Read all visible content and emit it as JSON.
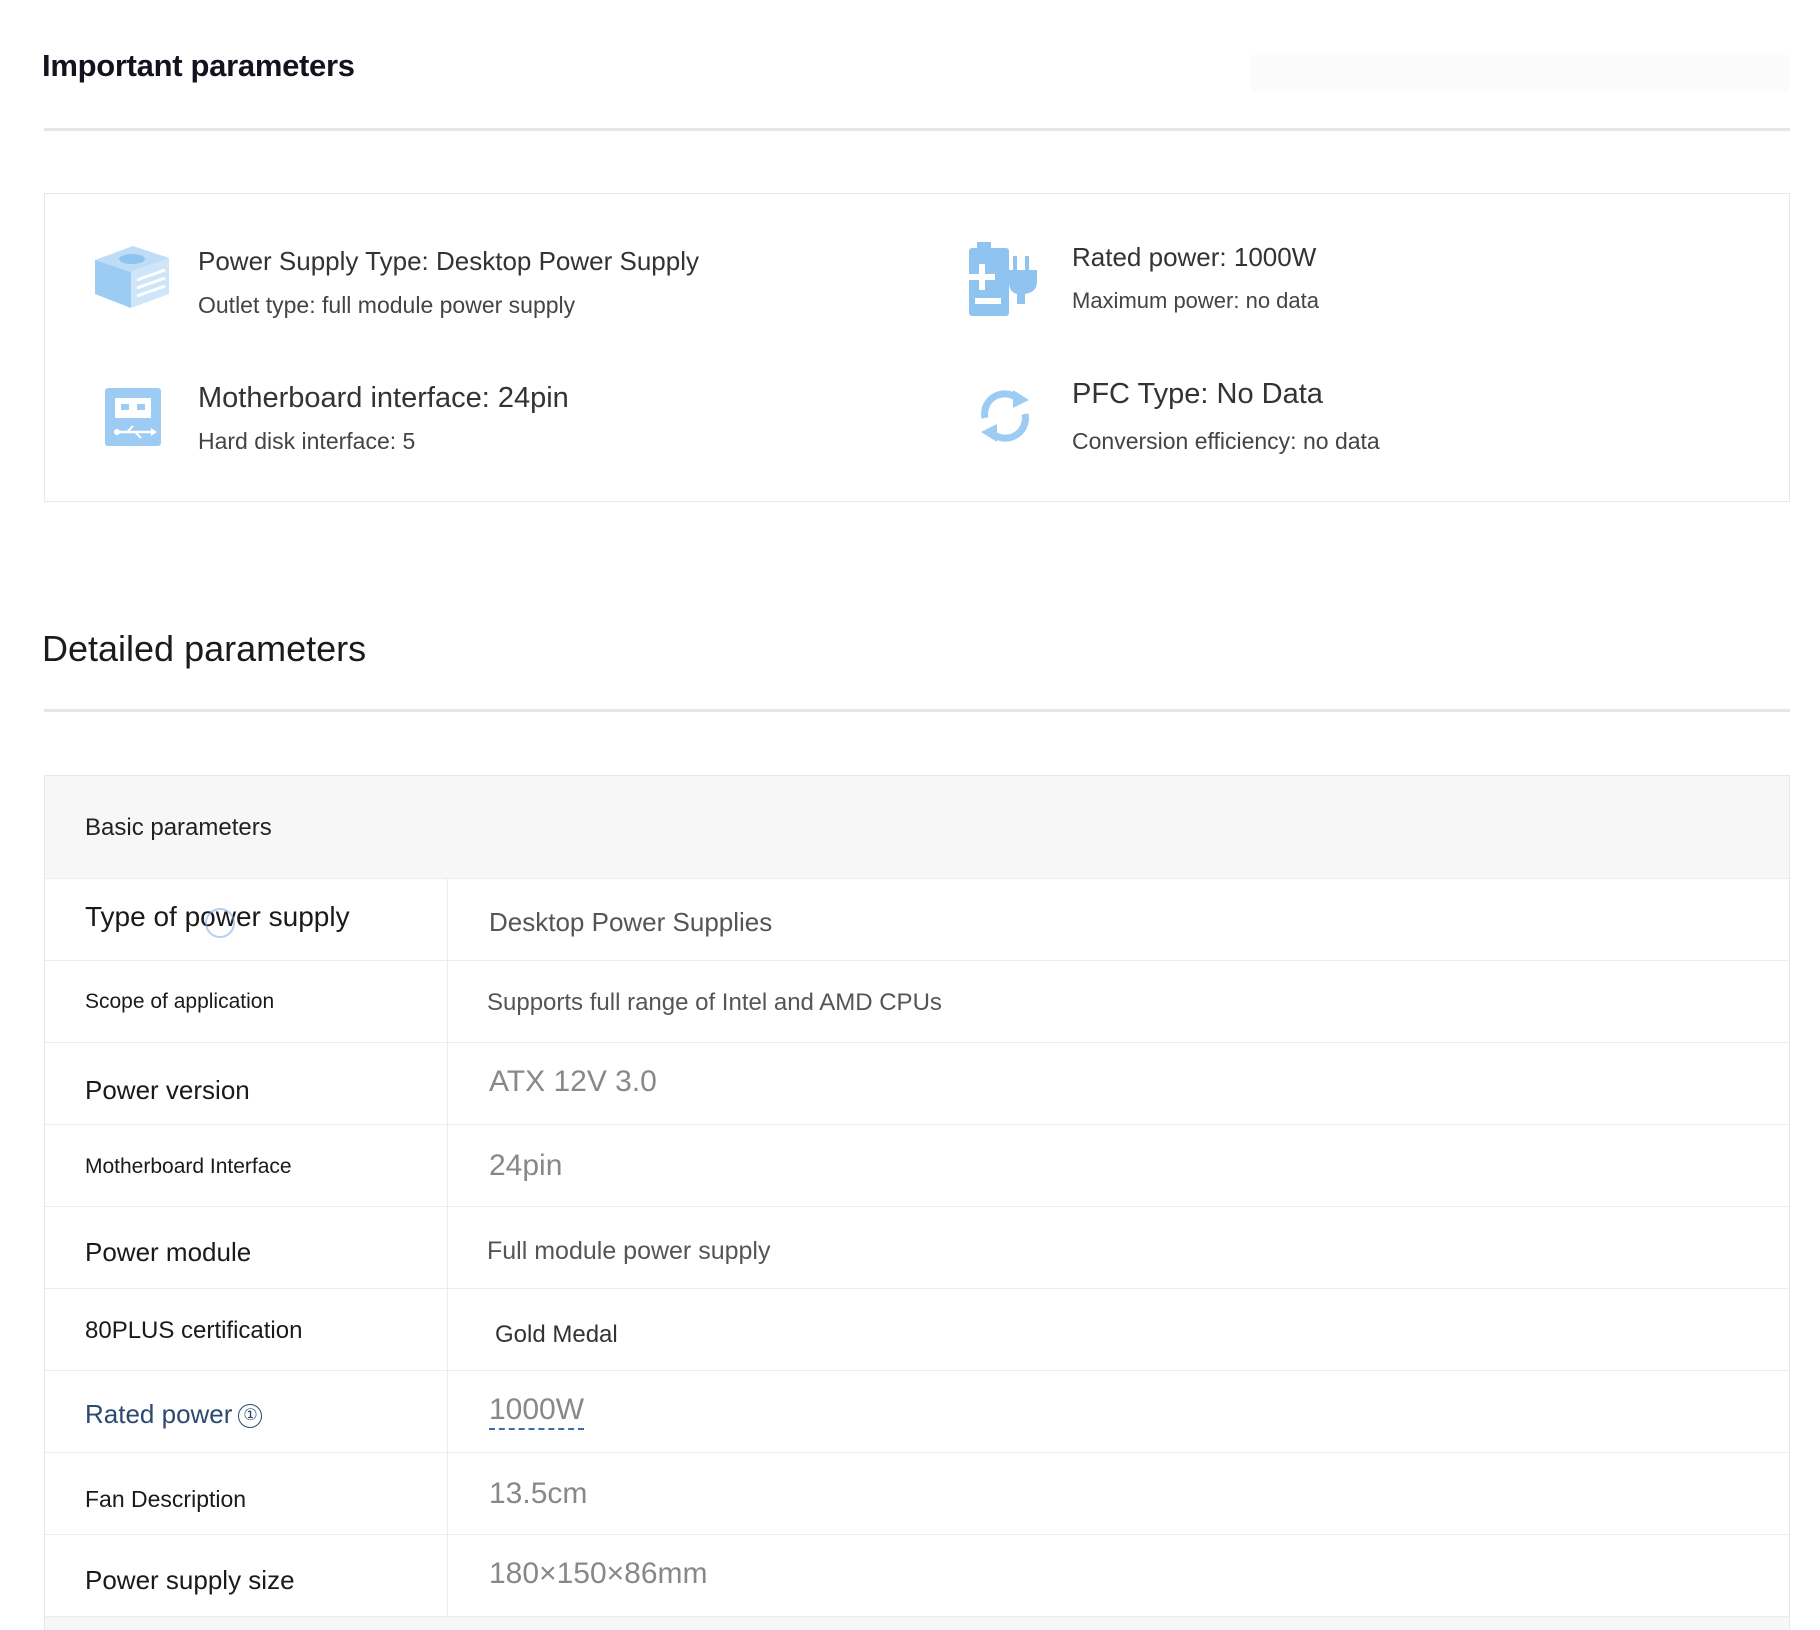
{
  "important": {
    "title": "Important parameters",
    "items": [
      {
        "icon": "power-supply-box-icon",
        "main": "Power Supply Type: Desktop Power Supply",
        "sub": "Outlet type: full module power supply"
      },
      {
        "icon": "battery-plug-icon",
        "main": "Rated power: 1000W",
        "sub": "Maximum power: no data"
      },
      {
        "icon": "usb-port-icon",
        "main": "Motherboard interface: 24pin",
        "sub": "Hard disk interface: 5"
      },
      {
        "icon": "refresh-cycle-icon",
        "main": "PFC Type: No Data",
        "sub": "Conversion efficiency: no data"
      }
    ]
  },
  "detailed": {
    "title": "Detailed parameters",
    "group": "Basic parameters",
    "rows": [
      {
        "label": "Type of power supply",
        "value": "Desktop Power Supplies"
      },
      {
        "label": "Scope of application",
        "value": "Supports full range of Intel and AMD CPUs"
      },
      {
        "label": "Power version",
        "value": "ATX 12V 3.0"
      },
      {
        "label": "Motherboard Interface",
        "value": "24pin"
      },
      {
        "label": "Power module",
        "value": "Full module power supply"
      },
      {
        "label": "80PLUS certification",
        "value": "Gold Medal"
      },
      {
        "label": "Rated power",
        "value": "1000W",
        "info": "①"
      },
      {
        "label": "Fan Description",
        "value": "13.5cm"
      },
      {
        "label": "Power supply size",
        "value": "180×150×86mm"
      }
    ]
  },
  "colors": {
    "icon_blue": "#8fc3f0",
    "link": "#2c4a6e",
    "dashed_underline": "#3d6ea8"
  }
}
